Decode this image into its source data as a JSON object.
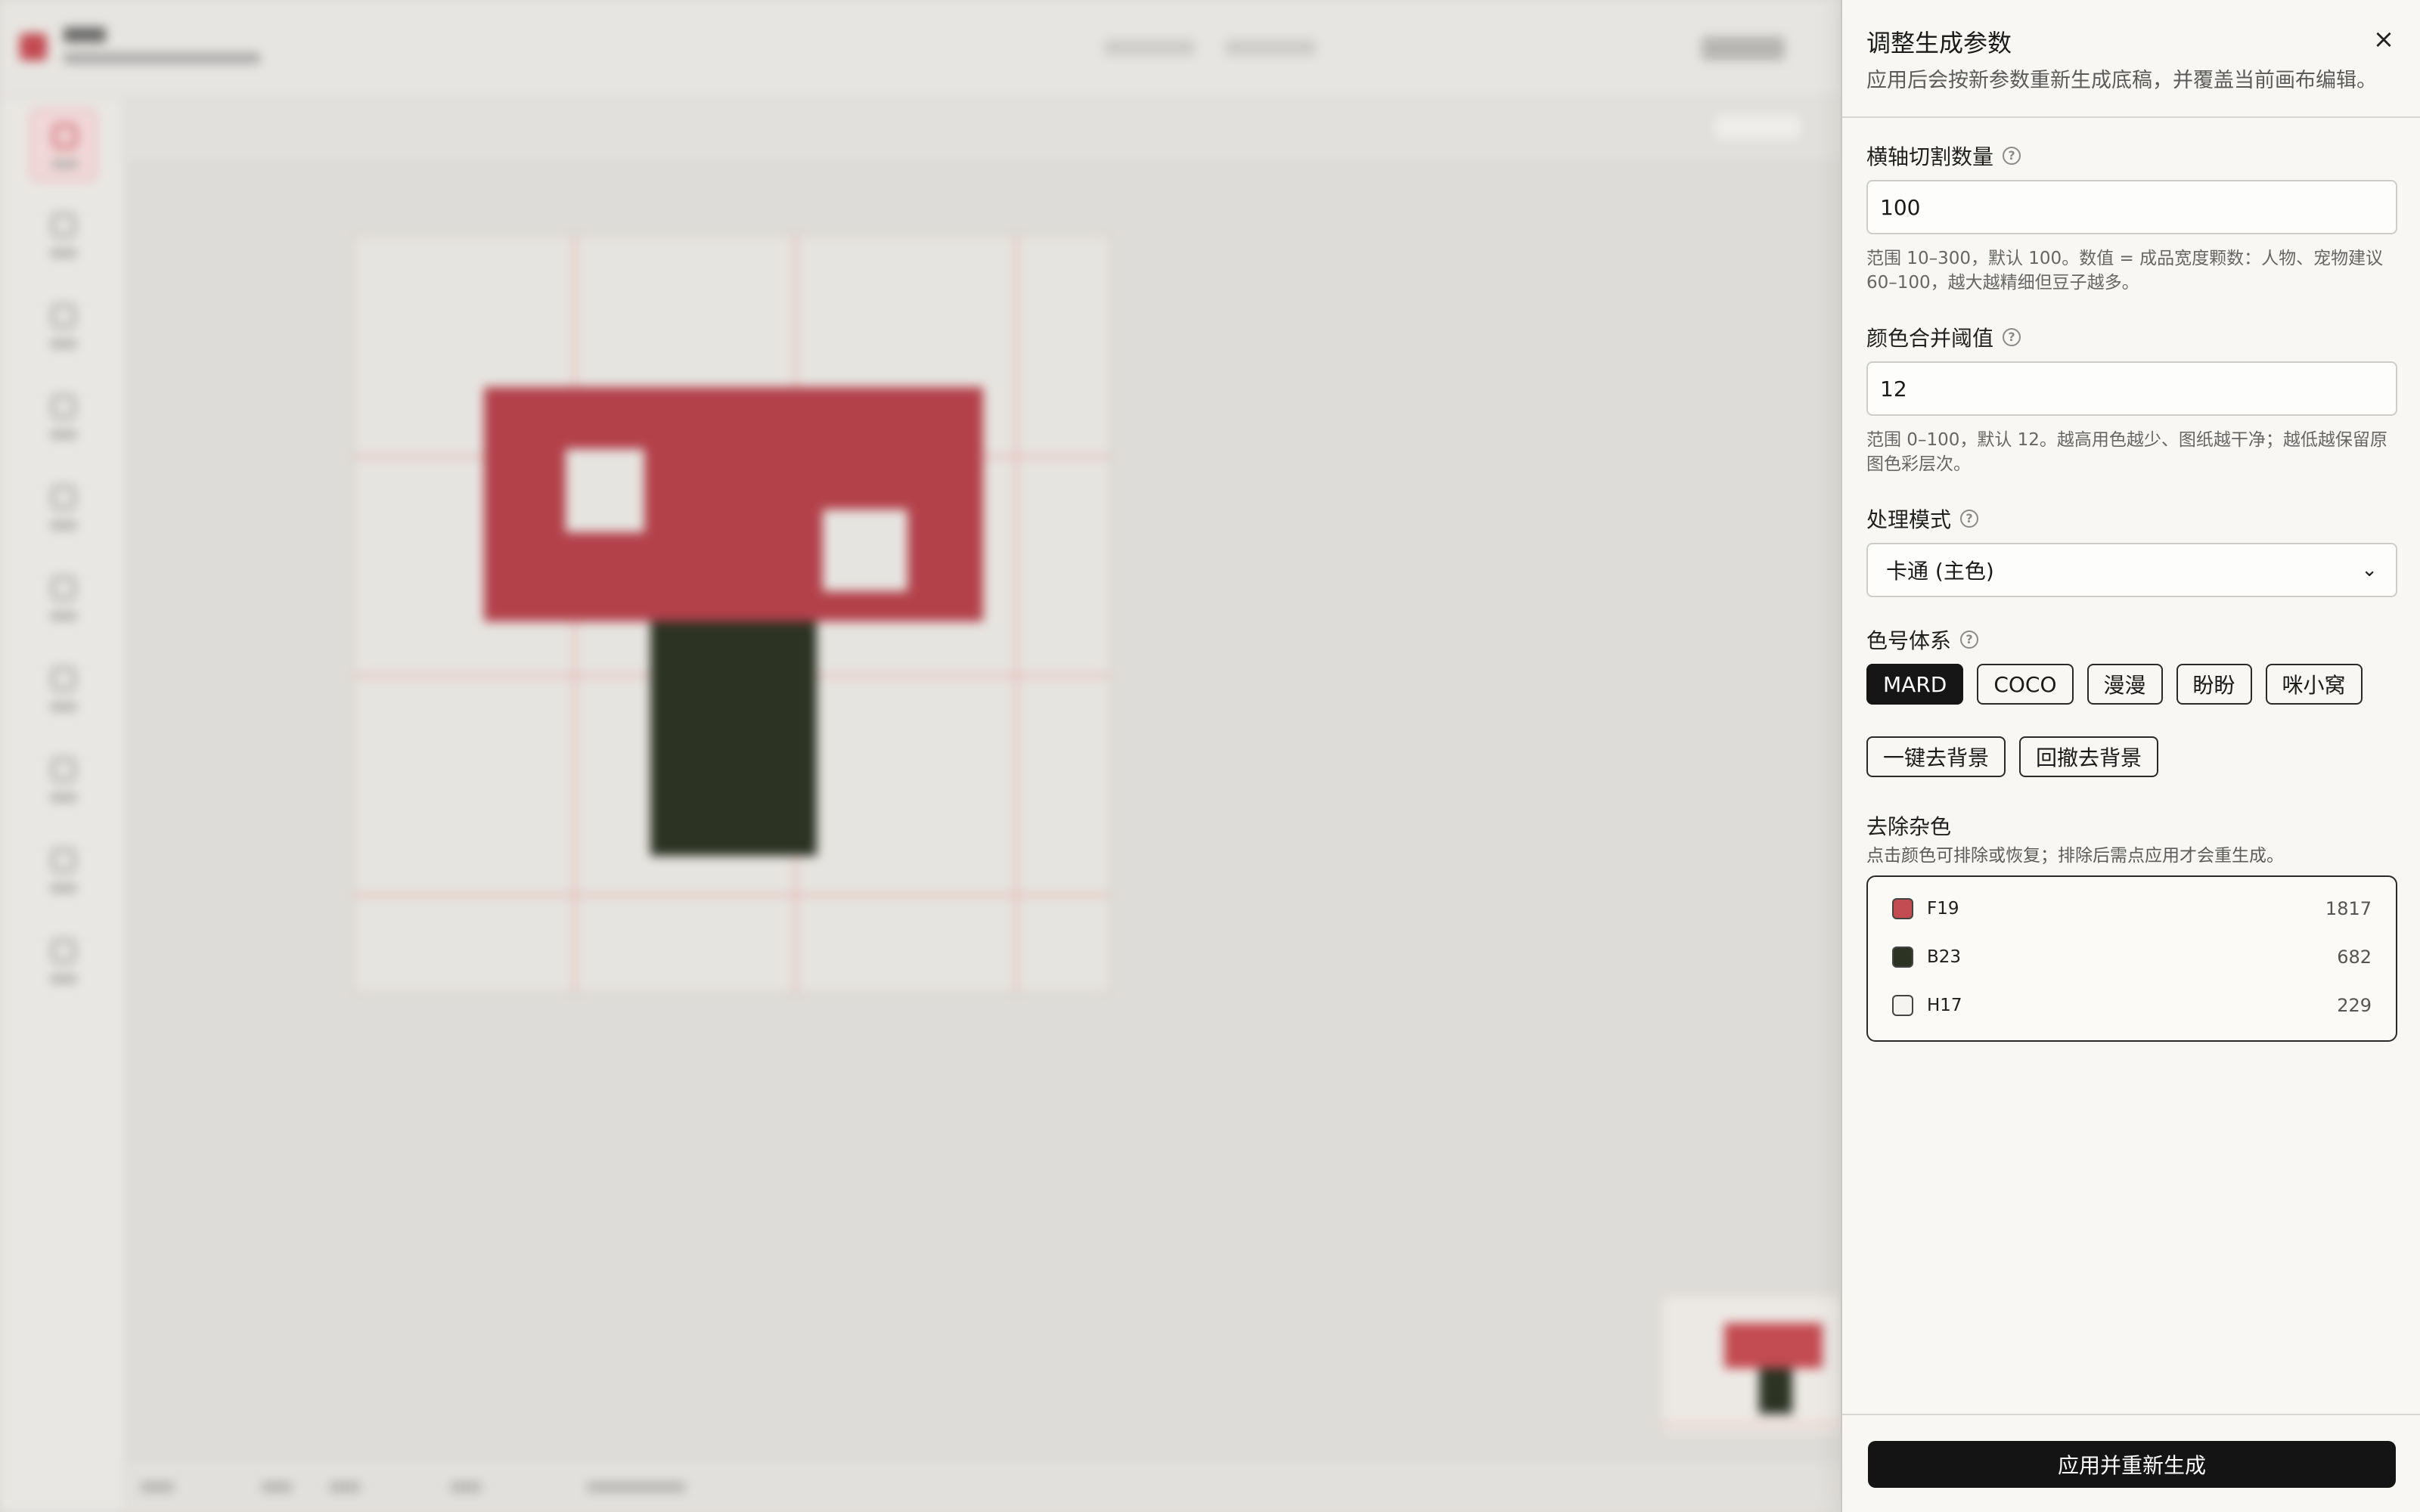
{
  "drawer": {
    "title": "调整生成参数",
    "description": "应用后会按新参数重新生成底稿，并覆盖当前画布编辑。",
    "close_icon": "×"
  },
  "fields": {
    "grid_count": {
      "label": "横轴切割数量",
      "value": "100",
      "hint": "范围 10–300，默认 100。数值 = 成品宽度颗数：人物、宠物建议 60–100，越大越精细但豆子越多。"
    },
    "merge_threshold": {
      "label": "颜色合并阈值",
      "value": "12",
      "hint": "范围 0–100，默认 12。越高用色越少、图纸越干净；越低越保留原图色彩层次。"
    },
    "mode": {
      "label": "处理模式",
      "selected": "卡通 (主色)"
    },
    "palette": {
      "label": "色号体系",
      "options": [
        "MARD",
        "COCO",
        "漫漫",
        "盼盼",
        "咪小窝"
      ],
      "selected": "MARD"
    }
  },
  "background_actions": {
    "remove": "一键去背景",
    "undo": "回撤去背景"
  },
  "noise_removal": {
    "title": "去除杂色",
    "subtitle": "点击颜色可排除或恢复；排除后需点应用才会重生成。",
    "colors": [
      {
        "code": "F19",
        "count": "1817",
        "color": "#c34b52"
      },
      {
        "code": "B23",
        "count": "682",
        "color": "#2c3323"
      },
      {
        "code": "H17",
        "count": "229",
        "color": "#f5f4f0"
      }
    ]
  },
  "footer": {
    "apply_label": "应用并重新生成"
  },
  "theme": {
    "accent_red": "#c34b52",
    "dark_green": "#2c3323",
    "primary_black": "#141414"
  }
}
